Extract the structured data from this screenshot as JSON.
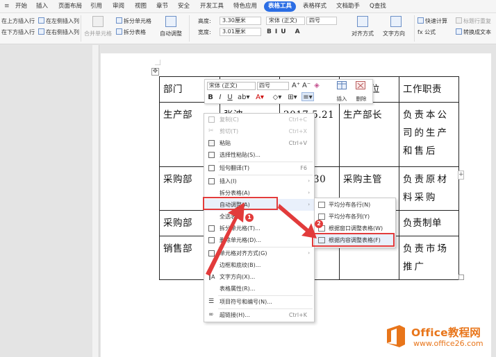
{
  "menubar": {
    "tabs": [
      "开始",
      "插入",
      "页面布局",
      "引用",
      "审阅",
      "视图",
      "章节",
      "安全",
      "开发工具",
      "特色应用",
      "表格工具",
      "表格样式",
      "文档助手"
    ],
    "active_tab": "表格工具",
    "search": "Q查找"
  },
  "ribbon": {
    "insert_above": "在上方插入行",
    "insert_left": "在左侧插入列",
    "insert_below": "在下方插入行",
    "insert_right": "在右侧插入列",
    "merge_cells": "合并单元格",
    "split_cells": "拆分单元格",
    "split_table": "拆分表格",
    "auto_fit": "自动调整",
    "height_label": "高度:",
    "height_value": "3.30厘米",
    "width_label": "宽度:",
    "width_value": "3.01厘米",
    "font_name": "宋体 (正文)",
    "font_size": "四号",
    "align": "对齐方式",
    "text_direction": "文字方向",
    "quick_calc": "快速计算",
    "repeat_title": "标题行重复",
    "formula": "fx 公式",
    "convert_text": "转换成文本"
  },
  "mini_toolbar": {
    "font_name": "宋体 (正文)",
    "font_size": "四号",
    "insert": "插入",
    "delete": "删除"
  },
  "table": {
    "rows": [
      [
        "部门",
        "",
        "",
        "位",
        "工作职责"
      ],
      [
        "生产部",
        "张波",
        "2017.5.21",
        "生产部长",
        "负责本公司的生产和售后"
      ],
      [
        "采购部",
        "",
        "30",
        "采购主管",
        "负责原材料采购"
      ],
      [
        "采购部",
        "",
        "",
        "",
        "负责制单"
      ],
      [
        "销售部",
        "",
        "",
        "",
        "负责市场推广"
      ]
    ]
  },
  "context_menu": {
    "items": [
      {
        "label": "复制(C)",
        "shortcut": "Ctrl+C",
        "disabled": true
      },
      {
        "label": "剪切(T)",
        "shortcut": "Ctrl+X",
        "disabled": true
      },
      {
        "label": "粘贴",
        "shortcut": "Ctrl+V",
        "disabled": false
      },
      {
        "label": "选择性粘贴(S)...",
        "shortcut": "",
        "disabled": false
      },
      {
        "label": "短句翻译(T)",
        "shortcut": "F6",
        "disabled": false
      },
      {
        "label": "插入(I)",
        "shortcut": "",
        "disabled": false
      },
      {
        "label": "拆分表格(A)",
        "shortcut": "",
        "disabled": false
      },
      {
        "label": "自动调整(A)",
        "shortcut": "",
        "disabled": false
      },
      {
        "label": "全选表格",
        "shortcut": "",
        "disabled": false
      },
      {
        "label": "拆分单元格(T)...",
        "shortcut": "",
        "disabled": false
      },
      {
        "label": "删除单元格(D)...",
        "shortcut": "",
        "disabled": false
      },
      {
        "label": "单元格对齐方式(G)",
        "shortcut": "",
        "disabled": false
      },
      {
        "label": "边框和底纹(B)...",
        "shortcut": "",
        "disabled": false
      },
      {
        "label": "文字方向(X)...",
        "shortcut": "",
        "disabled": false
      },
      {
        "label": "表格属性(R)...",
        "shortcut": "",
        "disabled": false
      },
      {
        "label": "项目符号和编号(N)...",
        "shortcut": "",
        "disabled": false
      },
      {
        "label": "超链接(H)...",
        "shortcut": "Ctrl+K",
        "disabled": false
      }
    ]
  },
  "submenu": {
    "items": [
      "平均分布各行(N)",
      "平均分布各列(Y)",
      "根据窗口调整表格(W)",
      "根据内容调整表格(F)"
    ]
  },
  "annotations": {
    "badge1": "1",
    "badge2": "2",
    "highlight_color": "#e23b3b"
  },
  "watermark": {
    "name": "Office教程网",
    "url": "www.office26.com"
  },
  "colors": {
    "accent": "#2b6de4",
    "watermark": "#e8751a"
  }
}
